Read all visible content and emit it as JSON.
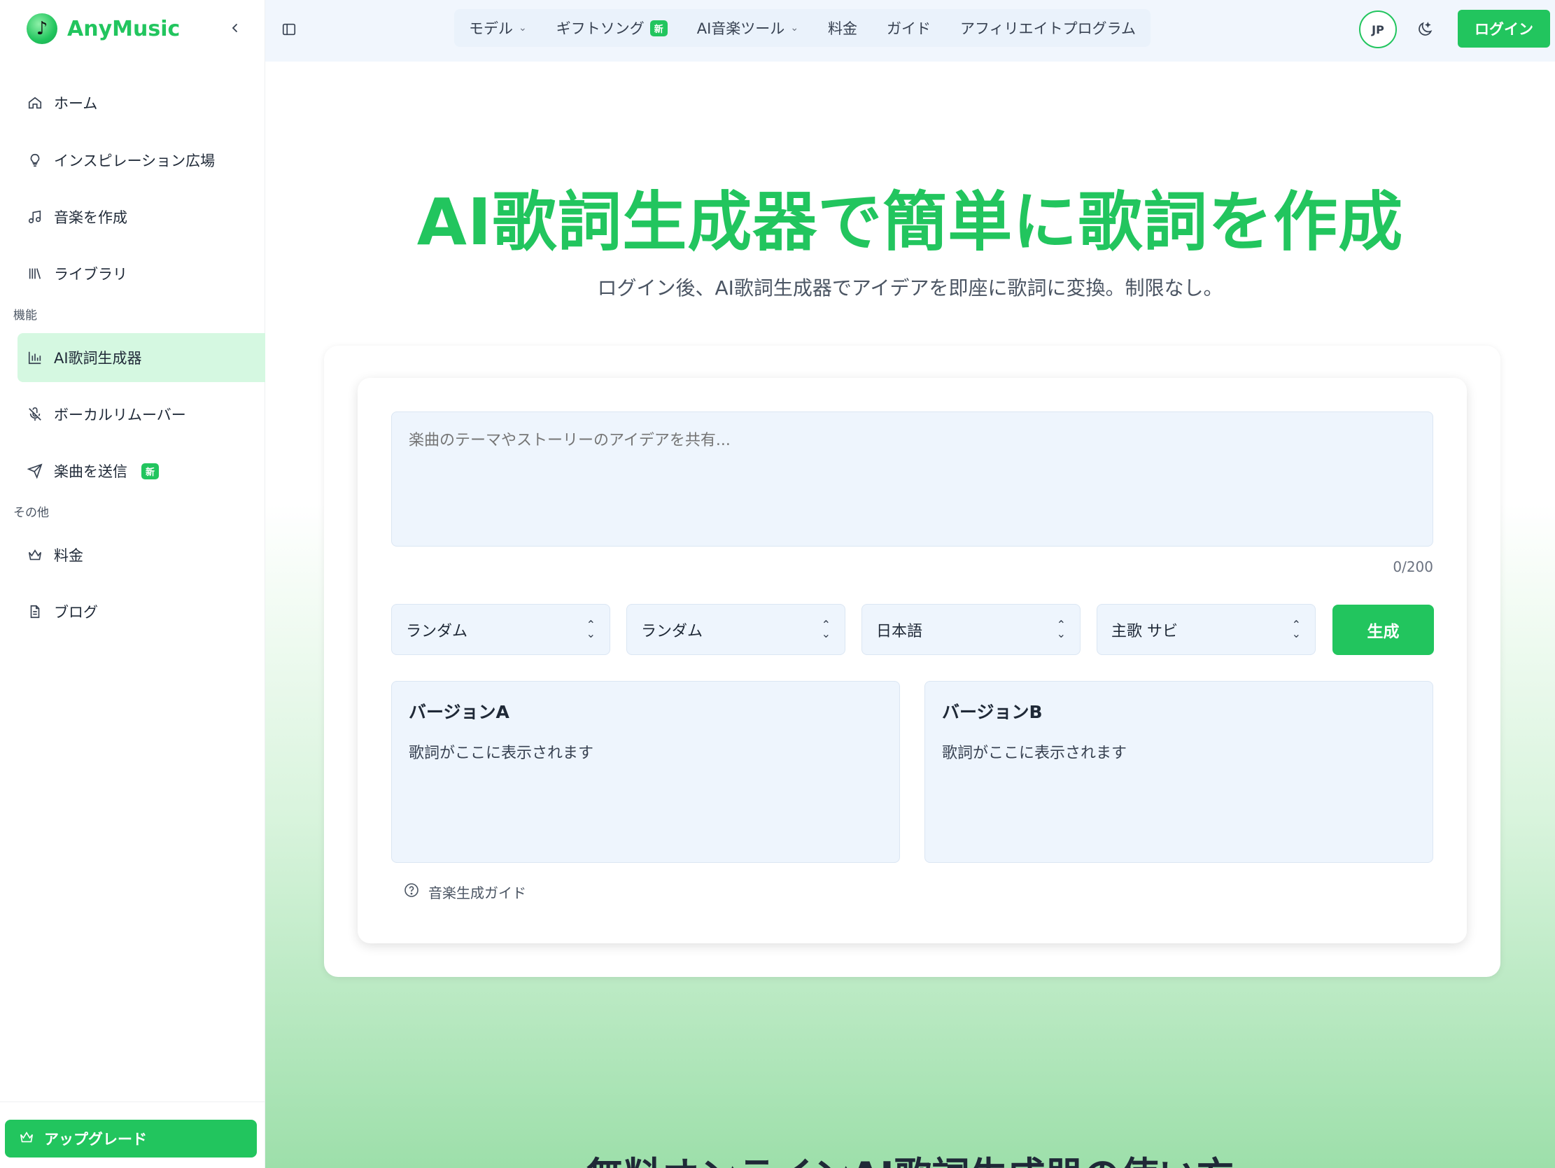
{
  "brand": {
    "name": "AnyMusic",
    "logo_glyph": "♪"
  },
  "sidebar": {
    "collapse_icon": "chevron-left-icon",
    "items": [
      {
        "label": "ホーム",
        "icon": "home-icon"
      },
      {
        "label": "インスピレーション広場",
        "icon": "lightbulb-icon"
      },
      {
        "label": "音楽を作成",
        "icon": "music-note-icon"
      },
      {
        "label": "ライブラリ",
        "icon": "library-icon"
      }
    ],
    "section_features": "機能",
    "feature_items": [
      {
        "label": "AI歌詞生成器",
        "icon": "bar-chart-icon",
        "active": true
      },
      {
        "label": "ボーカルリムーバー",
        "icon": "mic-off-icon"
      },
      {
        "label": "楽曲を送信",
        "icon": "send-icon",
        "badge": "新"
      }
    ],
    "section_other": "その他",
    "other_items": [
      {
        "label": "料金",
        "icon": "crown-icon"
      },
      {
        "label": "ブログ",
        "icon": "document-icon"
      }
    ],
    "upgrade_label": "アップグレード"
  },
  "topnav": {
    "menu": [
      {
        "label": "モデル",
        "has_dropdown": true
      },
      {
        "label": "ギフトソング",
        "badge": "新"
      },
      {
        "label": "AI音楽ツール",
        "has_dropdown": true
      },
      {
        "label": "料金"
      },
      {
        "label": "ガイド"
      },
      {
        "label": "アフィリエイトプログラム"
      }
    ],
    "language": "JP",
    "login_label": "ログイン"
  },
  "hero": {
    "title": "AI歌詞生成器で簡単に歌詞を作成",
    "subtitle": "ログイン後、AI歌詞生成器でアイデアを即座に歌詞に変換。制限なし。"
  },
  "generator": {
    "prompt_placeholder": "楽曲のテーマやストーリーのアイデアを共有...",
    "prompt_value": "",
    "counter": "0/200",
    "selects": [
      "ランダム",
      "ランダム",
      "日本語",
      "主歌 サビ"
    ],
    "generate_label": "生成",
    "version_a": {
      "title": "バージョンA",
      "body": "歌詞がここに表示されます"
    },
    "version_b": {
      "title": "バージョンB",
      "body": "歌詞がここに表示されます"
    },
    "guide_label": "音楽生成ガイド"
  },
  "next_section_heading": "無料オンラインAI歌詞生成器の使い方",
  "colors": {
    "accent": "#22c55e",
    "active_bg": "#d5f8e1",
    "field_bg": "#eef5fd"
  }
}
